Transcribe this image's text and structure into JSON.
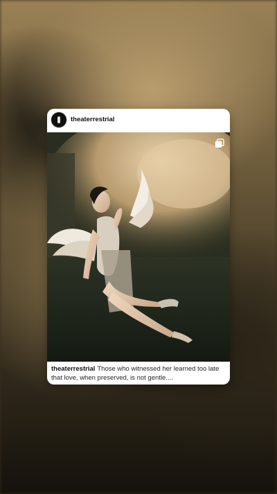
{
  "post": {
    "username": "theaterrestrial",
    "caption_user": "theaterrestrial",
    "caption_text": "Those who witnessed her learned too late that love, when preserved, is not gentle...."
  },
  "icons": {
    "avatar": "avatar-icon",
    "multi_image": "multi-image-icon"
  },
  "colors": {
    "card_bg": "#ffffff",
    "text": "#111111"
  }
}
